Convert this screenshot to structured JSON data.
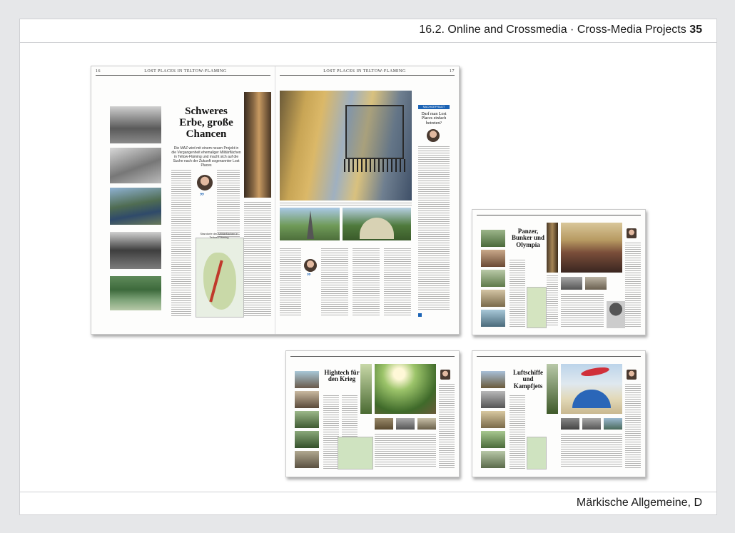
{
  "header": {
    "section": "16.2. Online and Crossmedia · Cross-Media Projects",
    "page_number": "35"
  },
  "footer": {
    "publication": "Märkische Allgemeine, D"
  },
  "spreads": {
    "main": {
      "left_folio": "16",
      "right_folio": "17",
      "left_running_head": "LOST PLACES IN TELTOW-FLÄMING",
      "right_running_head": "LOST PLACES IN TELTOW-FLÄMING",
      "headline": "Schweres Erbe, große Chancen",
      "deck": "Die MAZ wird mit einem neuen Projekt in die Vergangenheit ehemaliger Militärflächen in Teltow-Fläming und macht sich auf die Suche nach der Zukunft sogenannter Lost Places",
      "sidebar_label": "NACHGEFRAGT",
      "sidebar_headline": "Darf man Lost Places einfach betreten?",
      "map_caption": "Standorte der Militärflächen in Teltow-Fläming"
    },
    "panzer": {
      "headline": "Panzer, Bunker und Olympia"
    },
    "hightech": {
      "headline": "Hightech für den Krieg"
    },
    "luftschiffe": {
      "headline": "Luftschiffe und Kampfjets"
    }
  },
  "colors": {
    "frame_border": "#cfd0d3",
    "background": "#e6e7e9",
    "accent_blue": "#1b63b5"
  }
}
